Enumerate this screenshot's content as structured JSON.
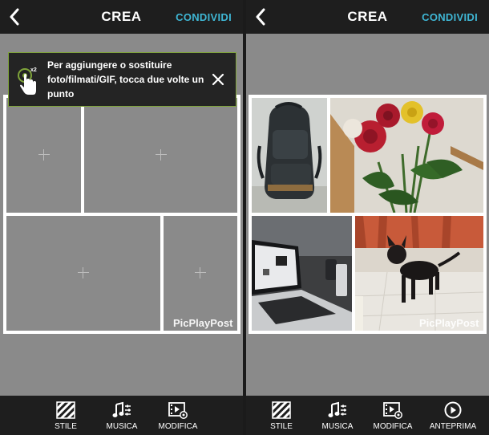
{
  "left": {
    "header": {
      "title": "CREA",
      "share_label": "CONDIVIDI"
    },
    "tooltip": {
      "badge": "x2",
      "text": "Per aggiungere o sostituire foto/filmati/GIF, tocca due volte un punto"
    },
    "watermark": "PicPlayPost",
    "toolbar": [
      {
        "label": "STILE",
        "icon": "stripes-icon"
      },
      {
        "label": "MUSICA",
        "icon": "music-note-icon"
      },
      {
        "label": "MODIFICA",
        "icon": "film-edit-icon"
      }
    ]
  },
  "right": {
    "header": {
      "title": "CREA",
      "share_label": "CONDIVIDI"
    },
    "photos": [
      "backpack-photo",
      "roses-photo",
      "laptop-photo",
      "dog-photo"
    ],
    "watermark": "PicPlayPost",
    "toolbar": [
      {
        "label": "STILE",
        "icon": "stripes-icon"
      },
      {
        "label": "MUSICA",
        "icon": "music-note-icon"
      },
      {
        "label": "MODIFICA",
        "icon": "film-edit-icon"
      },
      {
        "label": "ANTEPRIMA",
        "icon": "play-circle-icon"
      }
    ]
  },
  "colors": {
    "accent": "#3fb6d4",
    "tooltip_border": "#7fa43a",
    "bar": "#1e1e1e",
    "canvas": "#8a8a8a"
  }
}
